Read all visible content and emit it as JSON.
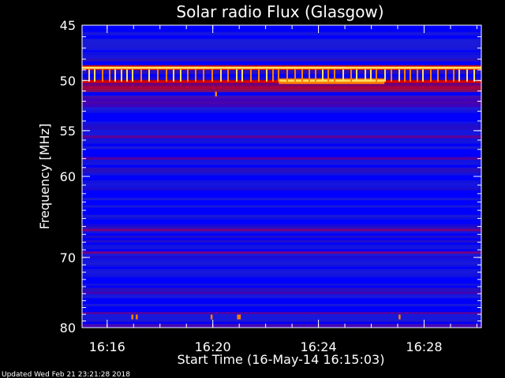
{
  "chart_data": {
    "type": "heatmap",
    "title": "Solar radio Flux (Glasgow)",
    "xlabel": "Start Time (16-May-14 16:15:03)",
    "ylabel": "Frequency [MHz]",
    "xlim": [
      "16:15:03",
      "16:30:10"
    ],
    "ylim": [
      45,
      80
    ],
    "y_ticks": [
      "45",
      "50",
      "55",
      "60",
      "70",
      "80"
    ],
    "x_ticks": [
      "16:16",
      "16:20",
      "16:24",
      "16:28"
    ],
    "colormap": [
      "#0000ff",
      "#1b1bd8",
      "#7a0080",
      "#d80000",
      "#ff8000",
      "#ffe060"
    ],
    "bright_bands_mhz": [
      48.8,
      50.1
    ],
    "burst_interval": [
      "16:22:30",
      "16:26:30"
    ],
    "grid": false
  },
  "footer": {
    "updated": "Updated Wed Feb 21 23:21:28 2018"
  }
}
